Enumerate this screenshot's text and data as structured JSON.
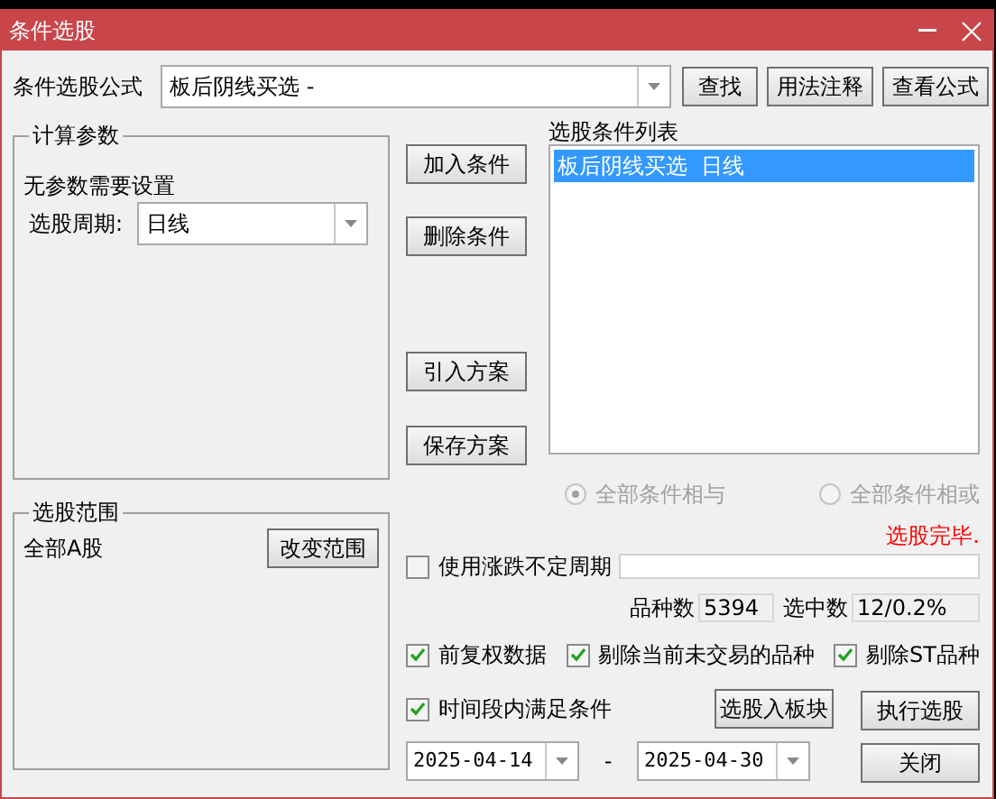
{
  "window": {
    "title": "条件选股"
  },
  "formula": {
    "label": "条件选股公式",
    "value": "板后阴线买选 -",
    "buttons": [
      "查找",
      "用法注释",
      "查看公式"
    ]
  },
  "params": {
    "title": "计算参数",
    "text": "无参数需要设置",
    "period_label": "选股周期:",
    "period_value": "日线"
  },
  "condition_buttons": [
    "加入条件",
    "删除条件",
    "引入方案",
    "保存方案"
  ],
  "conditions": {
    "title": "选股条件列表",
    "items": [
      {
        "text": "板后阴线买选  日线",
        "selected": true
      }
    ]
  },
  "logic": [
    {
      "label": "全部条件相与",
      "selected": true,
      "disabled": true
    },
    {
      "label": "全部条件相或",
      "selected": false,
      "disabled": true
    }
  ],
  "status": "选股完毕.",
  "range": {
    "title": "选股范围",
    "value": "全部A股",
    "button": "改变范围"
  },
  "variable_period": {
    "label": "使用涨跌不定周期",
    "checked": false
  },
  "counts": [
    {
      "label": "品种数",
      "value": "5394"
    },
    {
      "label": "选中数",
      "value": "12/0.2%"
    }
  ],
  "options": [
    {
      "label": "前复权数据",
      "checked": true
    },
    {
      "label": "剔除当前未交易的品种",
      "checked": true
    },
    {
      "label": "剔除ST品种",
      "checked": true
    }
  ],
  "period_check": {
    "label": "时间段内满足条件",
    "checked": true
  },
  "actions": [
    "选股入板块",
    "执行选股",
    "关闭"
  ],
  "dates": {
    "from": "2025-04-14",
    "separator": "-",
    "to": "2025-04-30"
  }
}
